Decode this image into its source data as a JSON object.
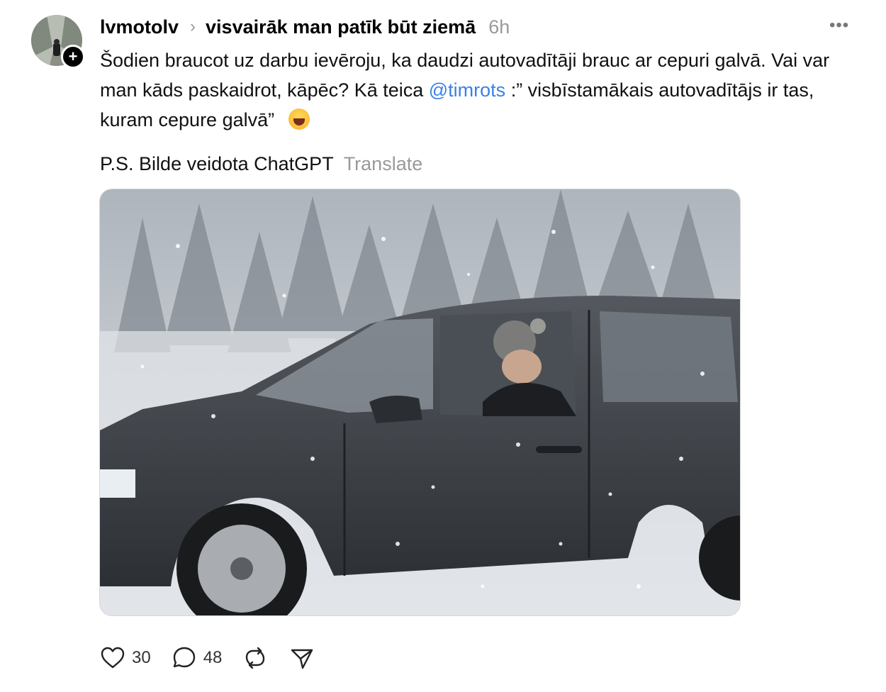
{
  "post": {
    "username": "lvmotolv",
    "topic": "visvairāk man patīk būt ziemā",
    "time": "6h",
    "text_part1": "Šodien braucot uz darbu ievēroju, ka daudzi autovadītāji brauc ar cepuri galvā. Vai var man kāds paskaidrot, kāpēc? Kā teica ",
    "mention": "@timrots",
    "text_part2": " :” visbīstamākais autovadītājs ir tas, kuram cepure galvā” ",
    "ps_text": "P.S. Bilde veidota ChatGPT",
    "translate_label": "Translate"
  },
  "actions": {
    "likes": "30",
    "replies": "48"
  },
  "icons": {
    "follow": "plus-icon",
    "more": "more-icon",
    "like": "heart-icon",
    "reply": "comment-icon",
    "repost": "repost-icon",
    "share": "send-icon"
  },
  "colors": {
    "mention": "#3a82e6",
    "muted": "#999999"
  }
}
